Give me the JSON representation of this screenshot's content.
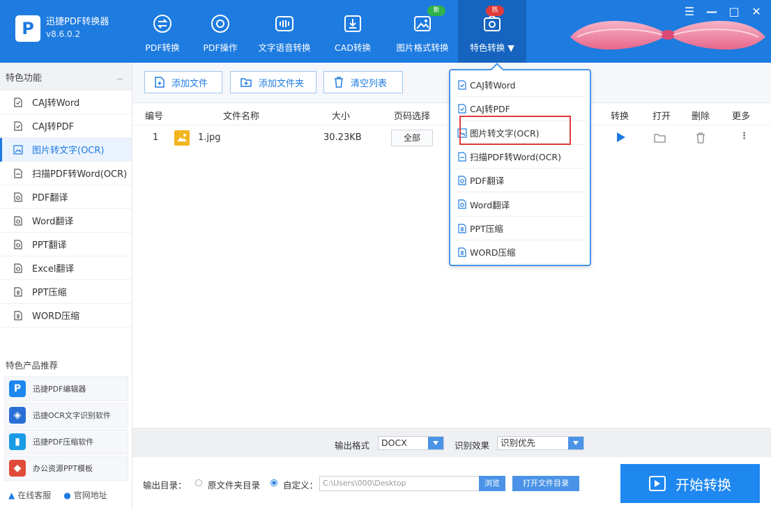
{
  "app": {
    "name": "迅捷PDF转换器",
    "version": "v8.6.0.2",
    "logo_letter": "P",
    "accent_color": "#1e7be0"
  },
  "nav": [
    {
      "label": "PDF转换",
      "icon": "swap-icon"
    },
    {
      "label": "PDF操作",
      "icon": "disc-icon"
    },
    {
      "label": "文字语音转换",
      "icon": "waveform-icon"
    },
    {
      "label": "CAD转换",
      "icon": "download-box-icon"
    },
    {
      "label": "图片格式转换",
      "icon": "image-icon",
      "badge": "新",
      "badge_color": "#2fb34a"
    },
    {
      "label": "特色转换",
      "icon": "camera-icon",
      "badge": "热",
      "badge_color": "#e03a3a",
      "dropdown": true
    }
  ],
  "window_controls": [
    "☰",
    "—",
    "□",
    "✕"
  ],
  "sidebar": {
    "title": "特色功能",
    "collapse_icon": "chevron-up-icon",
    "items": [
      {
        "label": "CAJ转Word",
        "icon": "doc-icon"
      },
      {
        "label": "CAJ转PDF",
        "icon": "doc-icon"
      },
      {
        "label": "图片转文字(OCR)",
        "icon": "image-icon",
        "active": true
      },
      {
        "label": "扫描PDF转Word(OCR)",
        "icon": "scan-icon"
      },
      {
        "label": "PDF翻译",
        "icon": "translate-icon"
      },
      {
        "label": "Word翻译",
        "icon": "translate-icon"
      },
      {
        "label": "PPT翻译",
        "icon": "translate-icon"
      },
      {
        "label": "Excel翻译",
        "icon": "translate-icon"
      },
      {
        "label": "PPT压缩",
        "icon": "compress-icon"
      },
      {
        "label": "WORD压缩",
        "icon": "compress-icon"
      }
    ],
    "products_title": "特色产品推荐",
    "products": [
      {
        "label": "迅捷PDF编辑器",
        "color": "#1e87f0",
        "glyph": "P"
      },
      {
        "label": "迅捷OCR文字识别软件",
        "color": "#2a6fd6",
        "glyph": "◈"
      },
      {
        "label": "迅捷PDF压缩软件",
        "color": "#1a9be6",
        "glyph": "▮"
      },
      {
        "label": "办公资源PPT模板",
        "color": "#e04b3a",
        "glyph": "◆"
      }
    ],
    "footer": [
      "在线客服",
      "官网地址"
    ]
  },
  "toolbar": {
    "add_file": "添加文件",
    "add_folder": "添加文件夹",
    "clear_list": "清空列表"
  },
  "table": {
    "headers": [
      "编号",
      "文件名称",
      "大小",
      "页码选择",
      "转换",
      "打开",
      "删除",
      "更多"
    ],
    "rows": [
      {
        "index": "1",
        "name": "1.jpg",
        "size": "30.23KB",
        "page": "全部"
      }
    ]
  },
  "dropdown": {
    "items": [
      {
        "label": "CAJ转Word",
        "icon": "doc-icon"
      },
      {
        "label": "CAJ转PDF",
        "icon": "doc-icon"
      },
      {
        "label": "图片转文字(OCR)",
        "icon": "image-icon",
        "highlighted": true
      },
      {
        "label": "扫描PDF转Word(OCR)",
        "icon": "scan-icon"
      },
      {
        "label": "PDF翻译",
        "icon": "translate-icon"
      },
      {
        "label": "Word翻译",
        "icon": "translate-icon"
      },
      {
        "label": "PPT压缩",
        "icon": "compress-icon"
      },
      {
        "label": "WORD压缩",
        "icon": "compress-icon"
      }
    ],
    "highlight_color": "#e03a3a"
  },
  "bottom": {
    "output_format_label": "输出格式",
    "output_format_value": "DOCX",
    "recognition_label": "识别效果",
    "recognition_value": "识别优先",
    "output_dir_label": "输出目录：",
    "option_source": "原文件夹目录",
    "option_custom": "自定义：",
    "path": "C:\\Users\\000\\Desktop",
    "browse": "浏览",
    "open_folder": "打开文件目录",
    "start": "开始转换"
  }
}
